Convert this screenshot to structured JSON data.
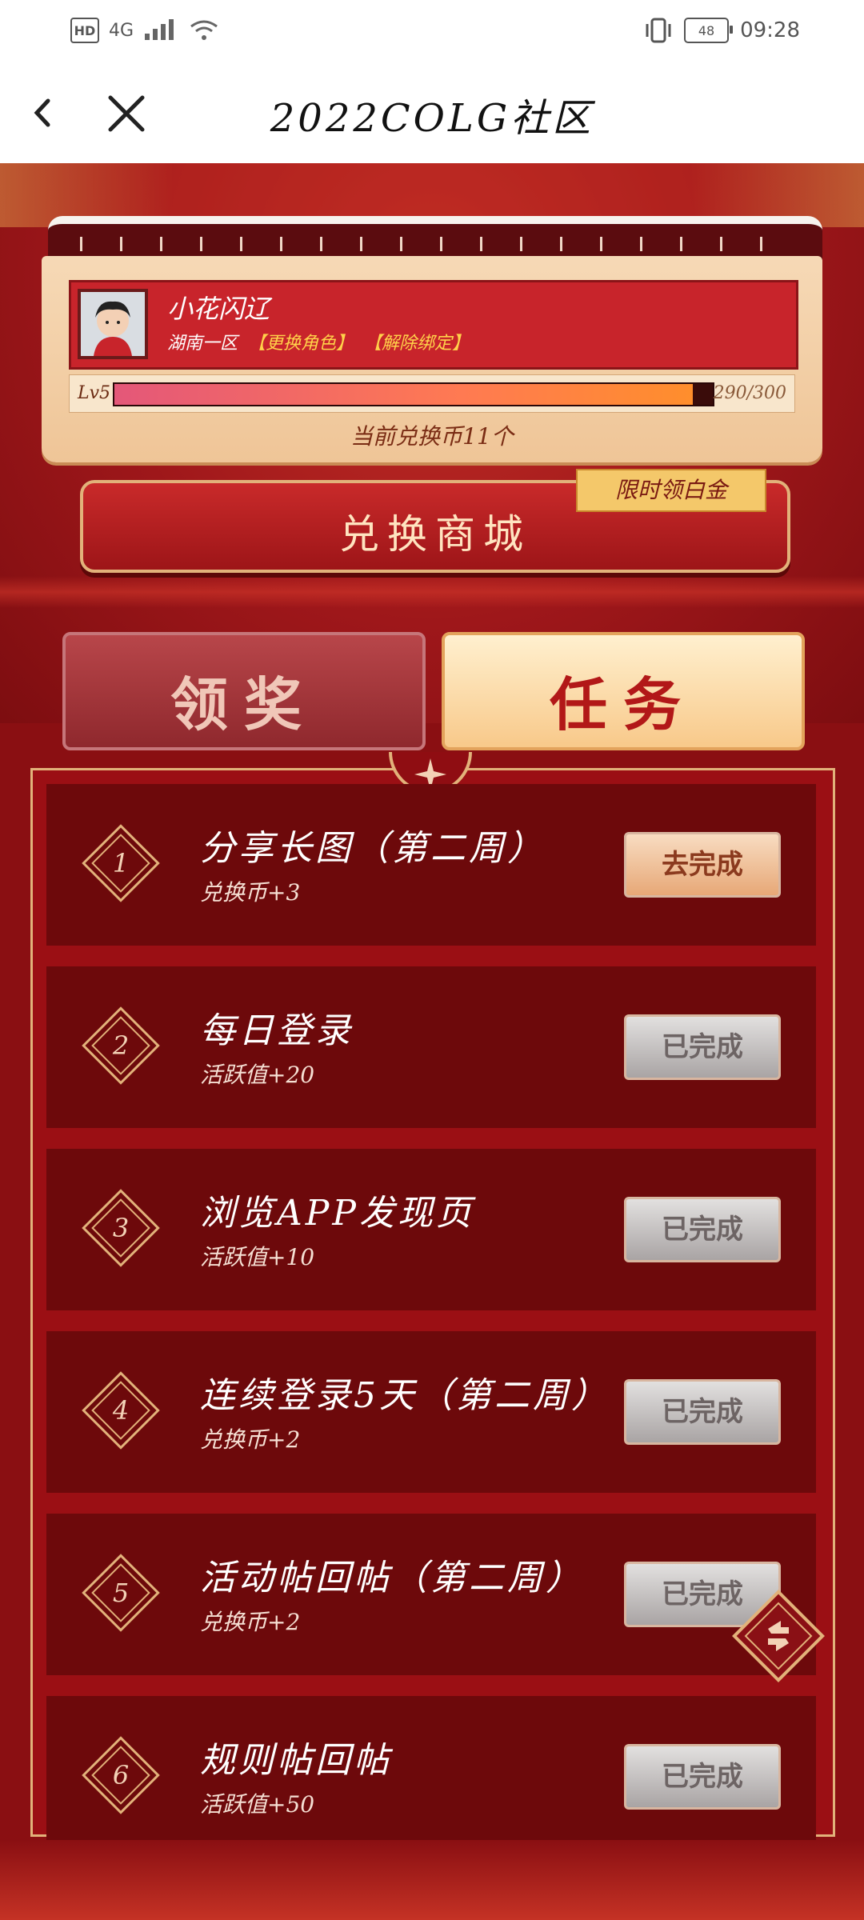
{
  "status_bar": {
    "network": "4G",
    "hd": "HD",
    "battery": "48",
    "time": "09:28"
  },
  "header": {
    "title": "2022COLG社区"
  },
  "profile": {
    "name": "小花闪辽",
    "server": "湖南一区",
    "change_role": "【更换角色】",
    "unbind": "【解除绑定】",
    "level_label": "Lv5",
    "progress": {
      "current": 290,
      "max": 300,
      "text": "290/300"
    },
    "coins_text": "当前兑换币11个"
  },
  "shop": {
    "label": "兑换商城",
    "tag": "限时领白金"
  },
  "tabs": [
    {
      "label": "领奖",
      "active": false
    },
    {
      "label": "任务",
      "active": true
    }
  ],
  "tasks": [
    {
      "num": "1",
      "title": "分享长图（第二周）",
      "reward": "兑换币+3",
      "button": "去完成",
      "done": false
    },
    {
      "num": "2",
      "title": "每日登录",
      "reward": "活跃值+20",
      "button": "已完成",
      "done": true
    },
    {
      "num": "3",
      "title": "浏览APP发现页",
      "reward": "活跃值+10",
      "button": "已完成",
      "done": true
    },
    {
      "num": "4",
      "title": "连续登录5天（第二周）",
      "reward": "兑换币+2",
      "button": "已完成",
      "done": true
    },
    {
      "num": "5",
      "title": "活动帖回帖（第二周）",
      "reward": "兑换币+2",
      "button": "已完成",
      "done": true
    },
    {
      "num": "6",
      "title": "规则帖回帖",
      "reward": "活跃值+50",
      "button": "已完成",
      "done": true
    }
  ],
  "colors": {
    "primary_red": "#9b0f14",
    "gold": "#e2b27a",
    "accent_yellow": "#ffd24a"
  }
}
